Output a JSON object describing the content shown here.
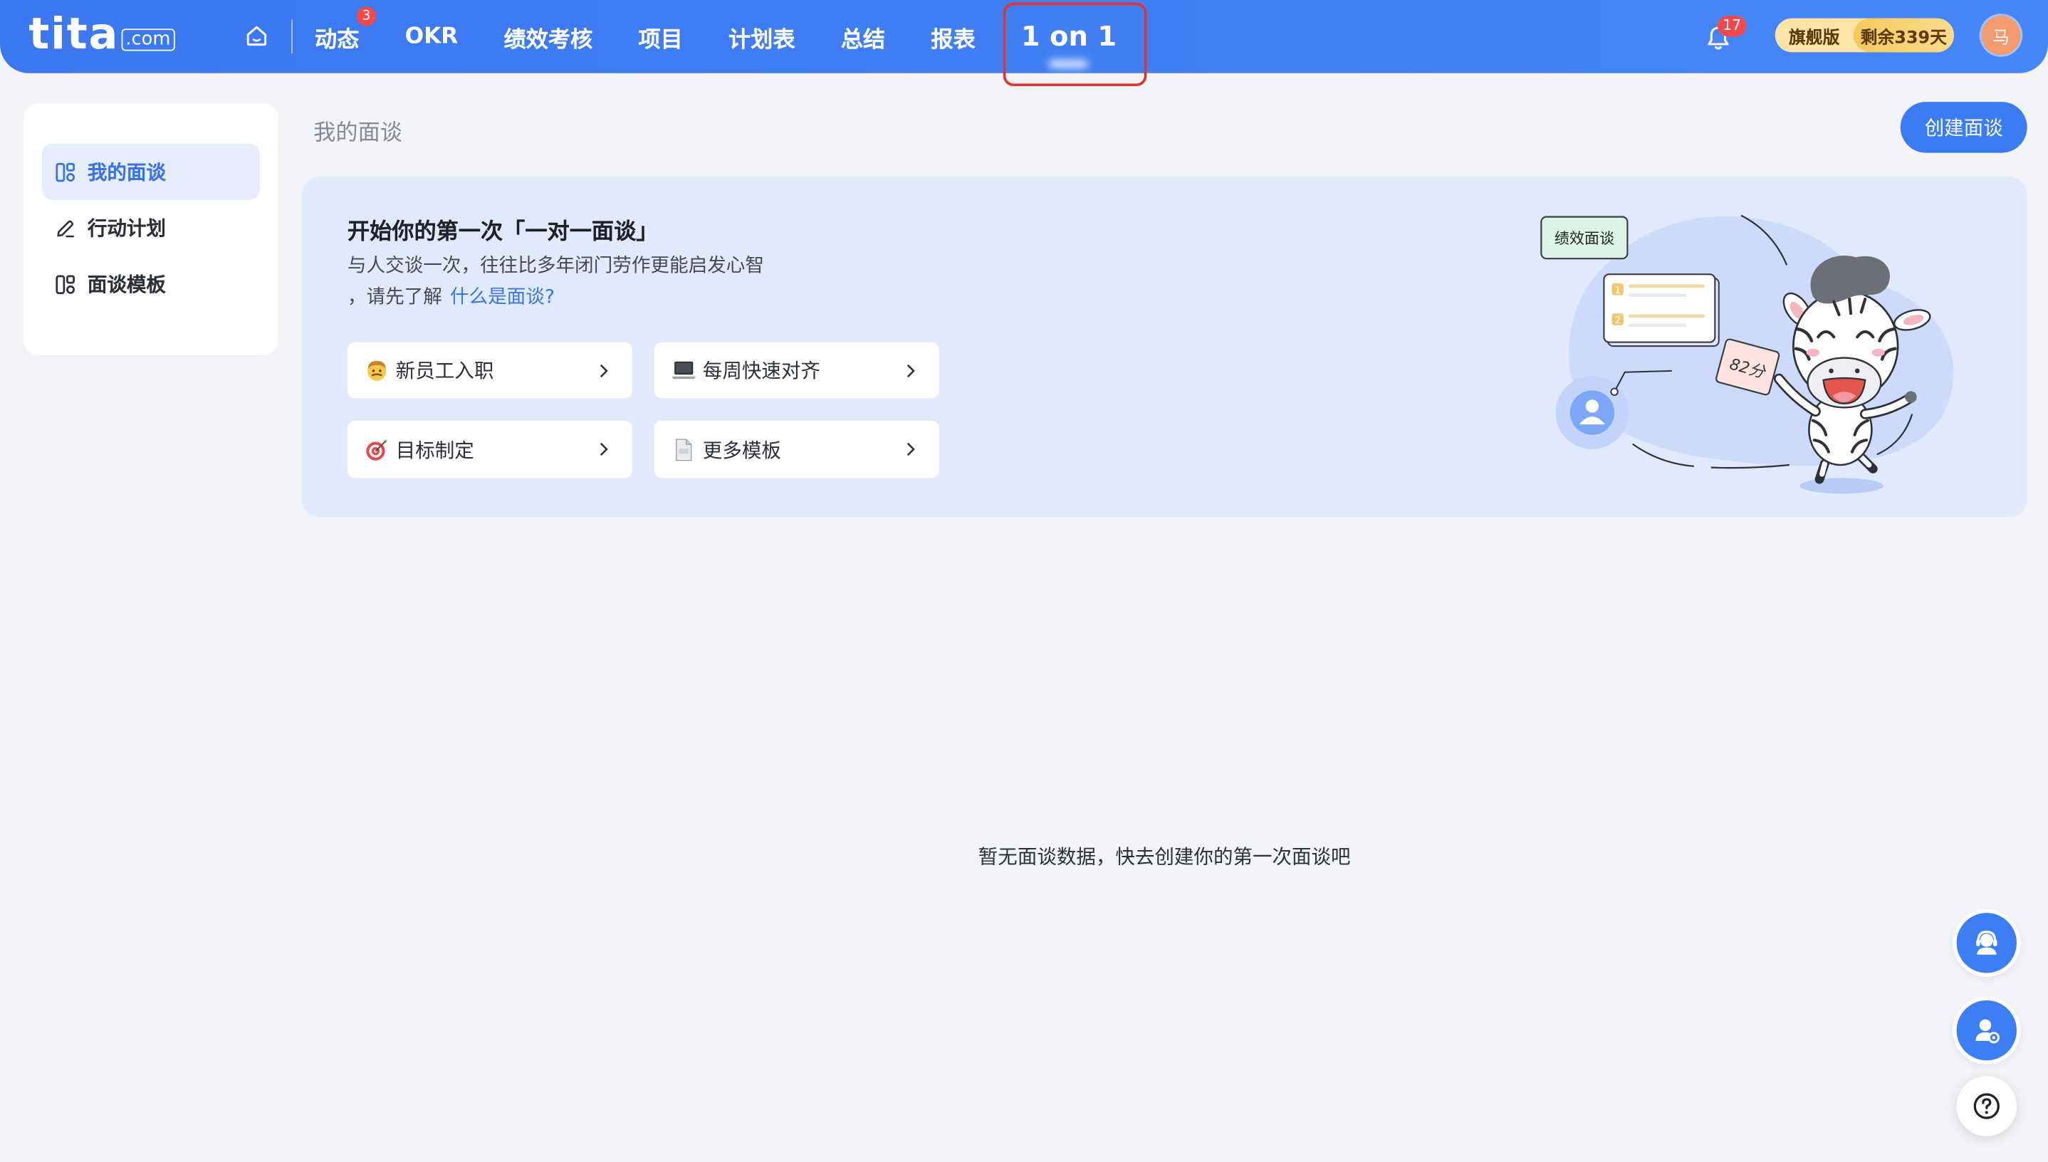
{
  "header": {
    "logo_main": "tita",
    "logo_suffix": ".com",
    "home_icon": "home-icon",
    "nav_items": [
      {
        "label": "动态",
        "badge": "3"
      },
      {
        "label": "OKR"
      },
      {
        "label": "绩效考核"
      },
      {
        "label": "项目"
      },
      {
        "label": "计划表"
      },
      {
        "label": "总结"
      },
      {
        "label": "报表"
      },
      {
        "label": "1 on 1",
        "active": true
      }
    ],
    "notification_icon": "bell-icon",
    "notification_count": "17",
    "plan_name": "旗舰版",
    "plan_remaining": "剩余339天",
    "avatar_text": "马"
  },
  "sidebar": {
    "items": [
      {
        "label": "我的面谈",
        "icon": "board-icon",
        "active": true
      },
      {
        "label": "行动计划",
        "icon": "pencil-icon"
      },
      {
        "label": "面谈模板",
        "icon": "board-icon"
      }
    ]
  },
  "main": {
    "title": "我的面谈",
    "create_button": "创建面谈",
    "banner": {
      "title": "开始你的第一次「一对一面谈」",
      "desc_line1": "与人交谈一次，往往比多年闭门劳作更能启发心智",
      "desc_line2_prefix": "，请先了解",
      "desc_link": "什么是面谈?",
      "templates": [
        {
          "label": "新员工入职",
          "icon": "man-face-icon"
        },
        {
          "label": "每周快速对齐",
          "icon": "laptop-icon"
        },
        {
          "label": "目标制定",
          "icon": "target-icon"
        },
        {
          "label": "更多模板",
          "icon": "document-icon"
        }
      ],
      "illustration": {
        "card_label": "绩效面谈",
        "score_label": "82分",
        "list_numbers": [
          "1",
          "2"
        ]
      }
    },
    "empty_text": "暂无面谈数据，快去创建你的第一次面谈吧"
  },
  "floating_buttons": [
    {
      "icon": "customer-service-icon"
    },
    {
      "icon": "user-settings-icon"
    },
    {
      "icon": "help-icon"
    }
  ],
  "colors": {
    "primary": "#3b7cf3",
    "nav_gradient_start": "#3b77f0",
    "nav_gradient_end": "#4686f6",
    "badge_red": "#f5484a",
    "banner_bg": "#e1eafc",
    "link": "#3b74e8",
    "highlight_box": "#e0342f",
    "page_bg": "#f2f4f8"
  }
}
